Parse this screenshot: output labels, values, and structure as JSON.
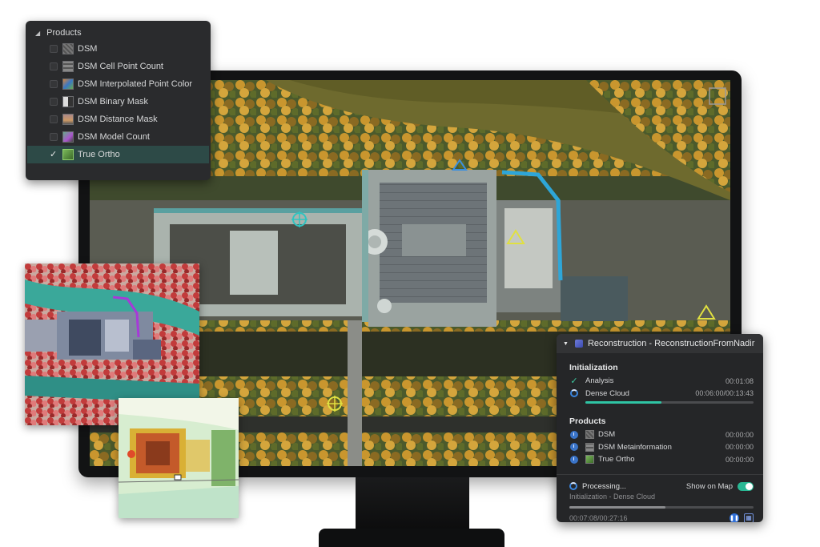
{
  "products_panel": {
    "title": "Products",
    "items": [
      {
        "label": "DSM",
        "checked": false
      },
      {
        "label": "DSM Cell Point Count",
        "checked": false
      },
      {
        "label": "DSM Interpolated Point Color",
        "checked": false
      },
      {
        "label": "DSM Binary Mask",
        "checked": false
      },
      {
        "label": "DSM Distance Mask",
        "checked": false
      },
      {
        "label": "DSM Model Count",
        "checked": false
      },
      {
        "label": "True Ortho",
        "checked": true
      }
    ]
  },
  "reconstruction": {
    "title": "Reconstruction - ReconstructionFromNadir",
    "initialization": {
      "heading": "Initialization",
      "steps": [
        {
          "label": "Analysis",
          "time": "00:01:08",
          "state": "done"
        },
        {
          "label": "Dense Cloud",
          "time": "00:06:00/00:13:43",
          "state": "running",
          "progress": 0.45
        }
      ]
    },
    "products": {
      "heading": "Products",
      "items": [
        {
          "label": "DSM",
          "time": "00:00:00"
        },
        {
          "label": "DSM Metainformation",
          "time": "00:00:00"
        },
        {
          "label": "True Ortho",
          "time": "00:00:00"
        }
      ]
    },
    "status": {
      "label": "Processing...",
      "show_on_map_label": "Show on Map",
      "show_on_map": true,
      "substep": "Initialization - Dense Cloud",
      "progress": 0.52,
      "elapsed": "00:07:08/00:27:16"
    }
  },
  "colors": {
    "accent_teal": "#2fc4a4",
    "accent_blue": "#2f6fd8",
    "panel_bg": "#252628",
    "selected_row": "#2d4a47"
  }
}
